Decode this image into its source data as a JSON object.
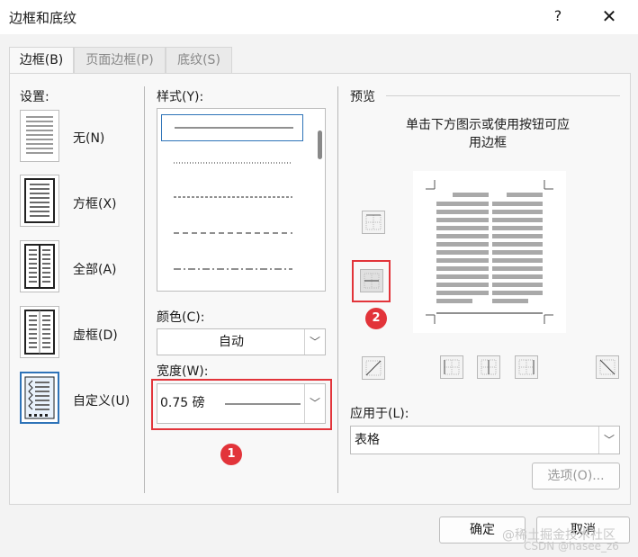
{
  "window": {
    "title": "边框和底纹",
    "help": "?",
    "close": "✕"
  },
  "tabs": [
    {
      "label": "边框(B)"
    },
    {
      "label": "页面边框(P)"
    },
    {
      "label": "底纹(S)"
    }
  ],
  "settings": {
    "label": "设置:",
    "items": [
      {
        "label": "无(N)",
        "icon": "no-border-icon"
      },
      {
        "label": "方框(X)",
        "icon": "box-border-icon"
      },
      {
        "label": "全部(A)",
        "icon": "all-borders-icon"
      },
      {
        "label": "虚框(D)",
        "icon": "grid-border-icon"
      },
      {
        "label": "自定义(U)",
        "icon": "custom-border-icon"
      }
    ]
  },
  "style": {
    "label": "样式(Y):"
  },
  "color": {
    "label": "颜色(C):",
    "value": "自动"
  },
  "width": {
    "label": "宽度(W):",
    "value": "0.75 磅"
  },
  "annotations": {
    "badge1": "1",
    "badge2": "2"
  },
  "preview": {
    "label": "预览",
    "hint_line1": "单击下方图示或使用按钮可应",
    "hint_line2": "用边框"
  },
  "apply_to": {
    "label": "应用于(L):",
    "value": "表格"
  },
  "buttons": {
    "options": "选项(O)...",
    "ok": "确定",
    "cancel": "取消"
  },
  "watermark": {
    "line1": "@稀土掘金技术社区",
    "line2": "CSDN @hasee_z6"
  },
  "colors": {
    "accent": "#2e73b8",
    "highlight": "#e2343a"
  }
}
